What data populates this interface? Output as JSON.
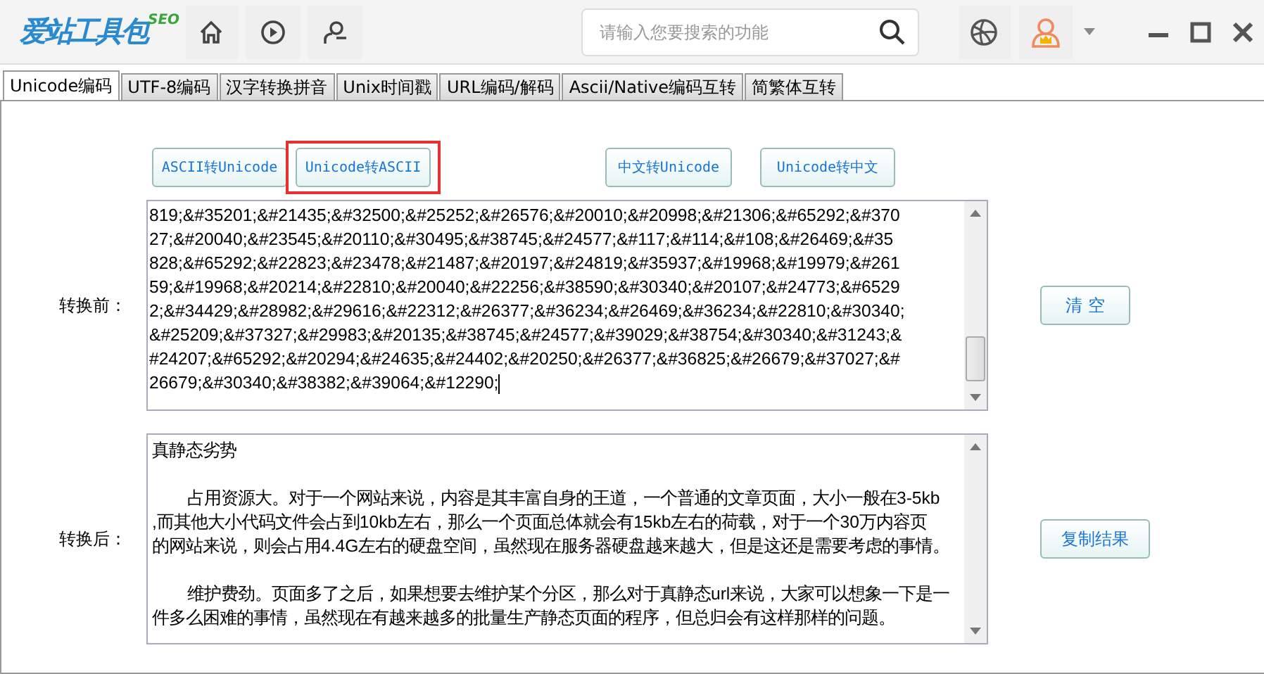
{
  "logo": {
    "name": "爱站工具包",
    "badge": "SEO"
  },
  "search": {
    "placeholder": "请输入您要搜索的功能"
  },
  "tabs": [
    {
      "label": "Unicode编码",
      "selected": true
    },
    {
      "label": "UTF-8编码",
      "selected": false
    },
    {
      "label": "汉字转换拼音",
      "selected": false
    },
    {
      "label": "Unix时间戳",
      "selected": false
    },
    {
      "label": "URL编码/解码",
      "selected": false
    },
    {
      "label": "Ascii/Native编码互转",
      "selected": false
    },
    {
      "label": "简繁体互转",
      "selected": false
    }
  ],
  "convert_buttons": [
    {
      "label": "ASCII转Unicode",
      "highlighted": false
    },
    {
      "label": "Unicode转ASCII",
      "highlighted": true
    },
    {
      "label": "中文转Unicode",
      "highlighted": false
    },
    {
      "label": "Unicode转中文",
      "highlighted": false
    }
  ],
  "input": {
    "label": "转换前：",
    "lines": [
      "819;&#35201;&#21435;&#32500;&#25252;&#26576;&#20010;&#20998;&#21306;&#65292;&#370",
      "27;&#20040;&#23545;&#20110;&#30495;&#38745;&#24577;&#117;&#114;&#108;&#26469;&#35",
      "828;&#65292;&#22823;&#23478;&#21487;&#20197;&#24819;&#35937;&#19968;&#19979;&#261",
      "59;&#19968;&#20214;&#22810;&#20040;&#22256;&#38590;&#30340;&#20107;&#24773;&#6529",
      "2;&#34429;&#28982;&#29616;&#22312;&#26377;&#36234;&#26469;&#36234;&#22810;&#30340;",
      "&#25209;&#37327;&#29983;&#20135;&#38745;&#24577;&#39029;&#38754;&#30340;&#31243;&",
      "#24207;&#65292;&#20294;&#24635;&#24402;&#20250;&#26377;&#36825;&#26679;&#37027;&#",
      "26679;&#30340;&#38382;&#39064;&#12290;"
    ],
    "action": "清 空"
  },
  "output": {
    "label": "转换后：",
    "title": "真静态劣势",
    "paragraphs": [
      [
        "占用资源大。对于一个网站来说，内容是其丰富自身的王道，一个普通的文章页面，大小一般在3-5kb",
        ",而其他大小代码文件会占到10kb左右，那么一个页面总体就会有15kb左右的荷载，对于一个30万内容页",
        "的网站来说，则会占用4.4G左右的硬盘空间，虽然现在服务器硬盘越来越大，但是这还是需要考虑的事情。"
      ],
      [
        "维护费劲。页面多了之后，如果想要去维护某个分区，那么对于真静态url来说，大家可以想象一下是一",
        "件多么困难的事情，虽然现在有越来越多的批量生产静态页面的程序，但总归会有这样那样的问题。"
      ]
    ],
    "action": "复制结果"
  }
}
